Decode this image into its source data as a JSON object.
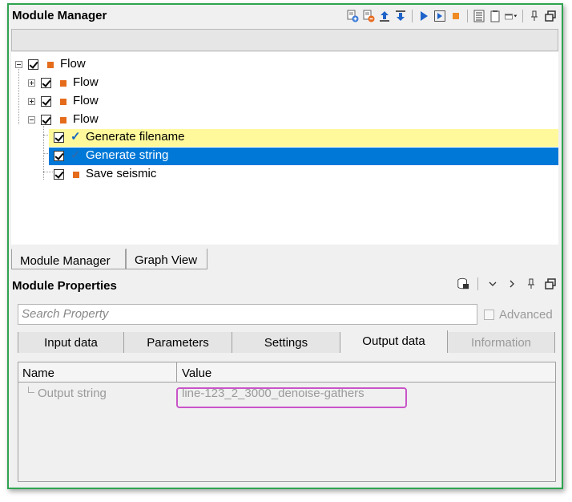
{
  "module_manager": {
    "title": "Module Manager",
    "toolbar_icons": [
      "add-module-icon",
      "remove-module-icon",
      "move-up-icon",
      "move-down-icon",
      "run-icon",
      "run-step-icon",
      "stop-icon",
      "list-icon",
      "page-icon",
      "window-menu-icon",
      "pin-icon",
      "float-window-icon"
    ],
    "tree": [
      {
        "label": "Flow",
        "checked": true,
        "icon": "orange-square",
        "expander": "minus"
      },
      {
        "label": "Flow",
        "checked": true,
        "icon": "orange-square",
        "expander": "plus"
      },
      {
        "label": "Flow",
        "checked": true,
        "icon": "orange-square",
        "expander": "plus"
      },
      {
        "label": "Flow",
        "checked": true,
        "icon": "orange-square",
        "expander": "minus"
      },
      {
        "label": "Generate filename",
        "checked": true,
        "icon": "blue-tick",
        "highlight": "yellow"
      },
      {
        "label": "Generate string",
        "checked": true,
        "icon": "blue-tick",
        "highlight": "selected"
      },
      {
        "label": "Save seismic",
        "checked": true,
        "icon": "orange-square"
      }
    ]
  },
  "view_tabs": {
    "module_manager": "Module Manager",
    "graph_view": "Graph View"
  },
  "module_properties": {
    "title": "Module Properties",
    "search_placeholder": "Search Property",
    "advanced_label": "Advanced",
    "tabs": {
      "input_data": "Input data",
      "parameters": "Parameters",
      "settings": "Settings",
      "output_data": "Output data",
      "information": "Information"
    },
    "active_tab": "Output data",
    "grid": {
      "col_name": "Name",
      "col_value": "Value",
      "rows": [
        {
          "name": "Output string",
          "value": "line-123_2_3000_denoise-gathers"
        }
      ]
    }
  },
  "colors": {
    "frame_border": "#2ea44f",
    "selected_row": "#0078d7",
    "highlight_row": "#fff99b",
    "flow_square": "#e46c1b",
    "annotation_box": "#c954c9"
  }
}
